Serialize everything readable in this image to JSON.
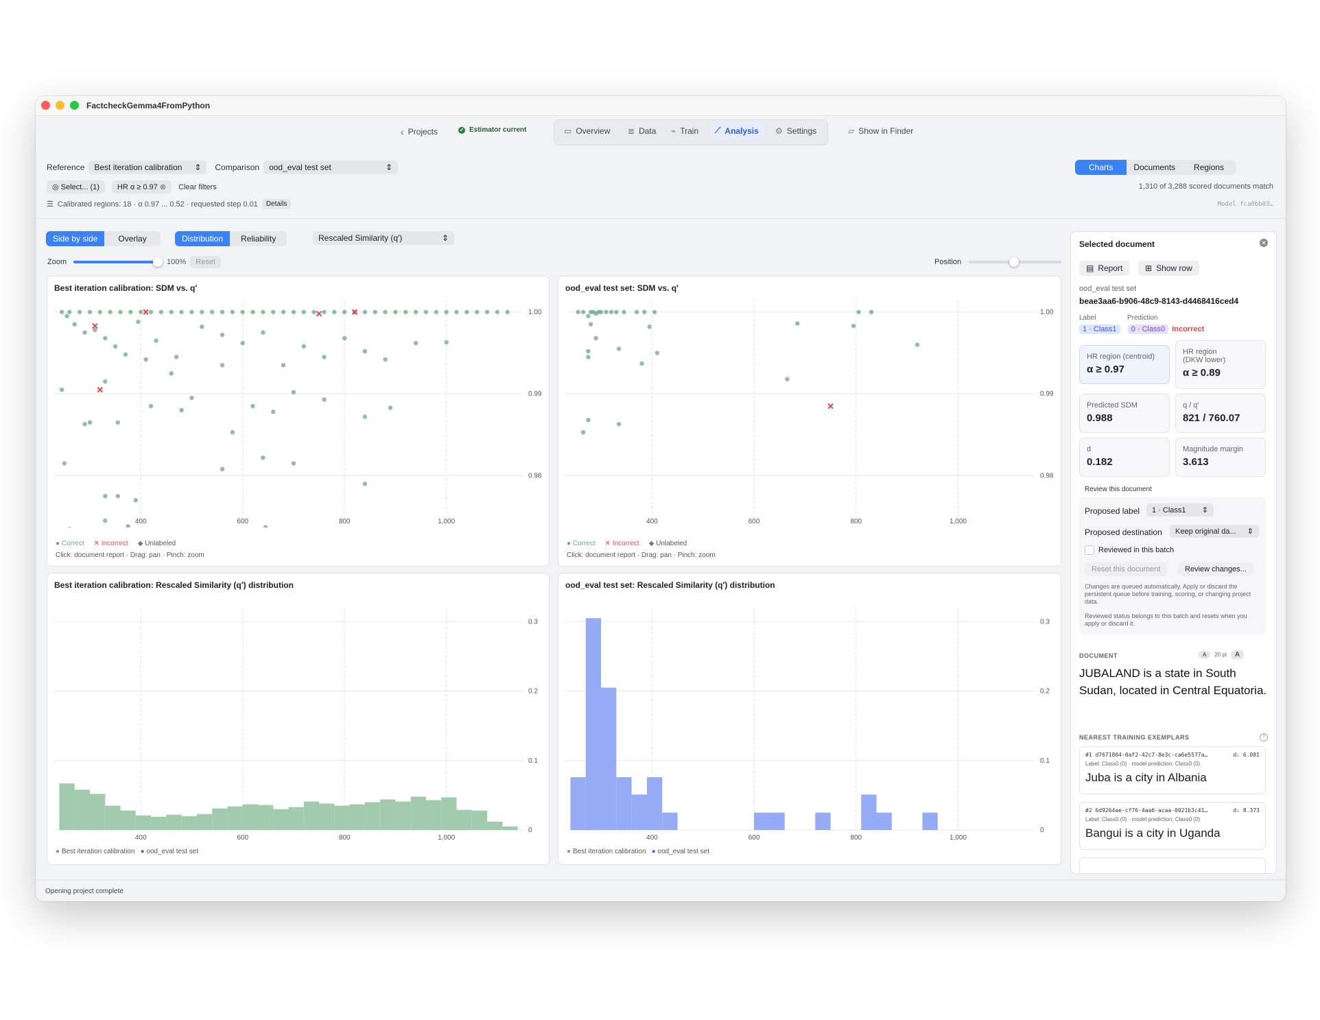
{
  "app": {
    "title": "FactcheckGemma4FromPython"
  },
  "toolbar": {
    "projects": "Projects",
    "estimator": "Estimator current",
    "tabs": [
      "Overview",
      "Data",
      "Train",
      "Analysis",
      "Settings"
    ],
    "show_in_finder": "Show in Finder"
  },
  "controls": {
    "reference_label": "Reference",
    "reference_value": "Best iteration calibration",
    "comparison_label": "Comparison",
    "comparison_value": "ood_eval test set",
    "select_chip": "Select... (1)",
    "hr_chip": "HR α ≥ 0.97",
    "clear_filters": "Clear filters",
    "regions_info": "Calibrated regions: 18 · α 0.97 ... 0.52 · requested step 0.01",
    "details_button": "Details",
    "view_tabs": [
      "Charts",
      "Documents",
      "Regions"
    ],
    "match_count": "1,310 of 3,288 scored documents match",
    "model_id": "Model fca0bb03…"
  },
  "chart_controls": {
    "layout": [
      "Side by side",
      "Overlay"
    ],
    "mode": [
      "Distribution",
      "Reliability"
    ],
    "metric": "Rescaled Similarity (q′)",
    "zoom_label": "Zoom",
    "zoom_value": "100%",
    "reset": "Reset",
    "position_label": "Position"
  },
  "panels": {
    "p1_title": "Best iteration calibration: SDM vs. q′",
    "p2_title": "ood_eval test set: SDM vs. q′",
    "p3_title": "Best iteration calibration: Rescaled Similarity (q′) distribution",
    "p4_title": "ood_eval test set: Rescaled Similarity (q′) distribution",
    "legend_correct": "Correct",
    "legend_incorrect": "Incorrect",
    "legend_unlabeled": "Unlabeled",
    "legend_ref": "Best iteration calibration",
    "legend_cmp": "ood_eval test set",
    "hint": "Click: document report · Drag: pan · Pinch: zoom"
  },
  "chart_data": [
    {
      "type": "scatter",
      "title": "Best iteration calibration: SDM vs. q′",
      "xlim": [
        230,
        1150
      ],
      "ylim": [
        0.9745,
        1.0015
      ],
      "xticks": [
        "400",
        "600",
        "800",
        "1,000"
      ],
      "yticks": [
        "1.00",
        "0.99",
        "0.98"
      ],
      "series": [
        {
          "name": "Correct",
          "points": [
            [
              245,
              1.0
            ],
            [
              260,
              1.0
            ],
            [
              280,
              1.0
            ],
            [
              300,
              1.0
            ],
            [
              320,
              1.0
            ],
            [
              340,
              1.0
            ],
            [
              360,
              1.0
            ],
            [
              380,
              1.0
            ],
            [
              400,
              1.0
            ],
            [
              420,
              1.0
            ],
            [
              440,
              1.0
            ],
            [
              460,
              1.0
            ],
            [
              480,
              1.0
            ],
            [
              500,
              1.0
            ],
            [
              520,
              1.0
            ],
            [
              540,
              1.0
            ],
            [
              560,
              1.0
            ],
            [
              580,
              1.0
            ],
            [
              600,
              1.0
            ],
            [
              620,
              1.0
            ],
            [
              640,
              1.0
            ],
            [
              660,
              1.0
            ],
            [
              680,
              1.0
            ],
            [
              700,
              1.0
            ],
            [
              720,
              1.0
            ],
            [
              740,
              1.0
            ],
            [
              760,
              1.0
            ],
            [
              780,
              1.0
            ],
            [
              800,
              1.0
            ],
            [
              820,
              1.0
            ],
            [
              840,
              1.0
            ],
            [
              860,
              1.0
            ],
            [
              880,
              1.0
            ],
            [
              900,
              1.0
            ],
            [
              920,
              1.0
            ],
            [
              940,
              1.0
            ],
            [
              960,
              1.0
            ],
            [
              980,
              1.0
            ],
            [
              1000,
              1.0
            ],
            [
              1020,
              1.0
            ],
            [
              1040,
              1.0
            ],
            [
              1060,
              1.0
            ],
            [
              1080,
              1.0
            ],
            [
              1100,
              1.0
            ],
            [
              1120,
              1.0
            ],
            [
              255,
              0.9995
            ],
            [
              270,
              0.9985
            ],
            [
              290,
              0.9975
            ],
            [
              310,
              0.9978
            ],
            [
              330,
              0.9968
            ],
            [
              350,
              0.9958
            ],
            [
              370,
              0.9948
            ],
            [
              395,
              0.9988
            ],
            [
              430,
              0.9965
            ],
            [
              470,
              0.9945
            ],
            [
              520,
              0.9982
            ],
            [
              560,
              0.9972
            ],
            [
              600,
              0.9962
            ],
            [
              640,
              0.9975
            ],
            [
              680,
              0.9935
            ],
            [
              720,
              0.9958
            ],
            [
              760,
              0.9945
            ],
            [
              800,
              0.9968
            ],
            [
              840,
              0.9952
            ],
            [
              880,
              0.9942
            ],
            [
              940,
              0.9962
            ],
            [
              1000,
              0.9963
            ],
            [
              245,
              0.9905
            ],
            [
              330,
              0.9915
            ],
            [
              410,
              0.9942
            ],
            [
              460,
              0.9925
            ],
            [
              500,
              0.9895
            ],
            [
              560,
              0.9935
            ],
            [
              620,
              0.9885
            ],
            [
              660,
              0.9878
            ],
            [
              700,
              0.9902
            ],
            [
              760,
              0.9893
            ],
            [
              840,
              0.9872
            ],
            [
              890,
              0.9883
            ],
            [
              300,
              0.9865
            ],
            [
              355,
              0.9865
            ],
            [
              420,
              0.9885
            ],
            [
              480,
              0.988
            ],
            [
              580,
              0.9853
            ],
            [
              640,
              0.9822
            ],
            [
              700,
              0.9815
            ],
            [
              250,
              0.9815
            ],
            [
              290,
              0.9863
            ],
            [
              560,
              0.9808
            ],
            [
              840,
              0.979
            ],
            [
              330,
              0.9775
            ],
            [
              355,
              0.9775
            ],
            [
              390,
              0.977
            ],
            [
              330,
              0.9745
            ],
            [
              375,
              0.9738
            ],
            [
              260,
              0.9735
            ],
            [
              645,
              0.9737
            ]
          ]
        },
        {
          "name": "Incorrect",
          "points": [
            [
              310,
              0.9983
            ],
            [
              320,
              0.9905
            ],
            [
              410,
              1.0
            ],
            [
              750,
              0.9998
            ],
            [
              820,
              1.0
            ]
          ]
        }
      ]
    },
    {
      "type": "scatter",
      "title": "ood_eval test set: SDM vs. q′",
      "xlim": [
        230,
        1150
      ],
      "ylim": [
        0.9745,
        1.0015
      ],
      "xticks": [
        "400",
        "600",
        "800",
        "1,000"
      ],
      "yticks": [
        "1.00",
        "0.99",
        "0.98"
      ],
      "series": [
        {
          "name": "Correct",
          "points": [
            [
              255,
              1.0
            ],
            [
              265,
              1.0
            ],
            [
              280,
              1.0
            ],
            [
              285,
              1.0
            ],
            [
              290,
              0.9998
            ],
            [
              295,
              1.0
            ],
            [
              300,
              1.0
            ],
            [
              310,
              1.0
            ],
            [
              320,
              1.0
            ],
            [
              330,
              1.0
            ],
            [
              345,
              1.0
            ],
            [
              370,
              1.0
            ],
            [
              385,
              1.0
            ],
            [
              405,
              1.0
            ],
            [
              275,
              0.9995
            ],
            [
              280,
              0.9985
            ],
            [
              290,
              0.9968
            ],
            [
              395,
              0.9982
            ],
            [
              275,
              0.9952
            ],
            [
              275,
              0.9945
            ],
            [
              335,
              0.9955
            ],
            [
              380,
              0.9937
            ],
            [
              410,
              0.995
            ],
            [
              685,
              0.9986
            ],
            [
              665,
              0.9918
            ],
            [
              795,
              0.9983
            ],
            [
              805,
              1.0
            ],
            [
              830,
              1.0
            ],
            [
              920,
              0.996
            ],
            [
              275,
              0.9868
            ],
            [
              335,
              0.9863
            ],
            [
              265,
              0.9853
            ]
          ]
        },
        {
          "name": "Incorrect",
          "points": [
            [
              750,
              0.9885
            ]
          ]
        }
      ]
    },
    {
      "type": "bar",
      "title": "Best iteration calibration: Rescaled Similarity (q′) distribution",
      "xlim": [
        230,
        1150
      ],
      "ylim": [
        0,
        0.32
      ],
      "bin_start": 240,
      "bin_width": 30,
      "xticks": [
        "400",
        "600",
        "800",
        "1,000"
      ],
      "yticks": [
        "0.3",
        "0.2",
        "0.1",
        "0"
      ],
      "series": [
        {
          "name": "Best iteration calibration",
          "values": [
            0.067,
            0.058,
            0.052,
            0.035,
            0.028,
            0.021,
            0.019,
            0.022,
            0.02,
            0.023,
            0.031,
            0.034,
            0.037,
            0.036,
            0.03,
            0.033,
            0.041,
            0.038,
            0.035,
            0.037,
            0.04,
            0.044,
            0.041,
            0.048,
            0.043,
            0.047,
            0.029,
            0.028,
            0.012,
            0.005
          ]
        }
      ]
    },
    {
      "type": "bar",
      "title": "ood_eval test set: Rescaled Similarity (q′) distribution",
      "xlim": [
        230,
        1150
      ],
      "ylim": [
        0,
        0.32
      ],
      "bin_start": 240,
      "bin_width": 30,
      "xticks": [
        "400",
        "600",
        "800",
        "1,000"
      ],
      "yticks": [
        "0.3",
        "0.2",
        "0.1",
        "0"
      ],
      "series": [
        {
          "name": "ood_eval test set",
          "values": [
            0.076,
            0.305,
            0.205,
            0.076,
            0.051,
            0.076,
            0.025,
            0,
            0,
            0,
            0,
            0,
            0.025,
            0.025,
            0,
            0,
            0.025,
            0,
            0,
            0.051,
            0.025,
            0,
            0,
            0.025,
            0,
            0,
            0,
            0,
            0,
            0
          ]
        }
      ]
    }
  ],
  "sidebar": {
    "title": "Selected document",
    "report_btn": "Report",
    "show_row_btn": "Show row",
    "dataset": "ood_eval test set",
    "doc_id": "beae3aa6-b906-48c9-8143-d4468416ced4",
    "label_label": "Label",
    "label_value": "1 · Class1",
    "prediction_label": "Prediction",
    "prediction_value": "0 · Class0",
    "prediction_status": "Incorrect",
    "cards": [
      {
        "k": "HR region (centroid)",
        "v": "α ≥ 0.97"
      },
      {
        "k": "HR region\n(DKW lower)",
        "v": "α ≥ 0.89"
      },
      {
        "k": "Predicted SDM",
        "v": "0.988"
      },
      {
        "k": "q / q′",
        "v": "821 / 760.07"
      },
      {
        "k": "d",
        "v": "0.182"
      },
      {
        "k": "Magnitude margin",
        "v": "3.613"
      }
    ],
    "review_title": "Review this document",
    "proposed_label": "Proposed label",
    "proposed_label_value": "1 · Class1",
    "proposed_dest": "Proposed destination",
    "proposed_dest_value": "Keep original da...",
    "reviewed_check": "Reviewed in this batch",
    "reset_doc": "Reset this document",
    "review_changes": "Review changes...",
    "note1": "Changes are queued automatically. Apply or discard the persistent queue before training, scoring, or changing project data.",
    "note2": "Reviewed status belongs to this batch and resets when you apply or discard it.",
    "doc_heading": "DOCUMENT",
    "font_small": "A",
    "font_size": "20 pt",
    "font_large": "A",
    "doc_text": "JUBALAND is a state in South Sudan, located in Central Equatoria.",
    "nearest_heading": "NEAREST TRAINING EXEMPLARS",
    "exemplars": [
      {
        "id": "#1  d7671804-0af2-42c7-8e3c-ca6e5577a…",
        "dist": "dᵢ 6.081",
        "meta": "Label: Class0 (0) · model prediction: Class0 (0)",
        "text": "Juba is a city in Albania"
      },
      {
        "id": "#2  6d9264ae-cf76-4aa6-acaa-0021b3c41…",
        "dist": "dᵢ 8.373",
        "meta": "Label: Class0 (0) · model prediction: Class0 (0)",
        "text": "Bangui is a city in Uganda"
      }
    ]
  },
  "status": {
    "text": "Opening project complete"
  },
  "colors": {
    "accent": "#3b82f6",
    "correct": "#6aa884",
    "incorrect": "#e0484d",
    "ref_bar": "#9cc8a8",
    "cmp_bar": "#8fa7f4"
  }
}
